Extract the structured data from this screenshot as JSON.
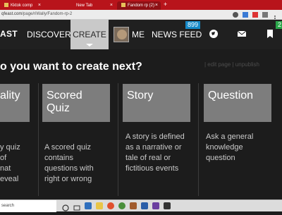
{
  "browser": {
    "tabs": [
      {
        "label": "Kktok comp"
      },
      {
        "label": "New Tab"
      },
      {
        "label": "Fandom rp (2)"
      }
    ],
    "new_tab": "+",
    "close": "×",
    "url_prefix": "qfeast.com",
    "url_path": "/page/riWally/Fandom-rp-2"
  },
  "header": {
    "logo": "AST",
    "nav": [
      {
        "label": "DISCOVER"
      },
      {
        "label": "CREATE"
      },
      {
        "label": "ME"
      },
      {
        "label": "NEWS FEED"
      }
    ],
    "news_badge": "899",
    "right_badge": "2"
  },
  "main": {
    "headline": "o you want to create next?",
    "ghost_text": "| edit page | unpublish",
    "cards": [
      {
        "title": "ality",
        "desc": "y quiz\nof\nnat\neveal"
      },
      {
        "title": "Scored\nQuiz",
        "desc": "A scored quiz\ncontains\nquestions with\nright or wrong"
      },
      {
        "title": "Story",
        "desc": "A story is defined\nas a narrative or\ntale of real or\nfictitious events"
      },
      {
        "title": "Question",
        "desc": "Ask a general\nknowledge\nquestion"
      }
    ]
  },
  "taskbar": {
    "search": "search"
  }
}
